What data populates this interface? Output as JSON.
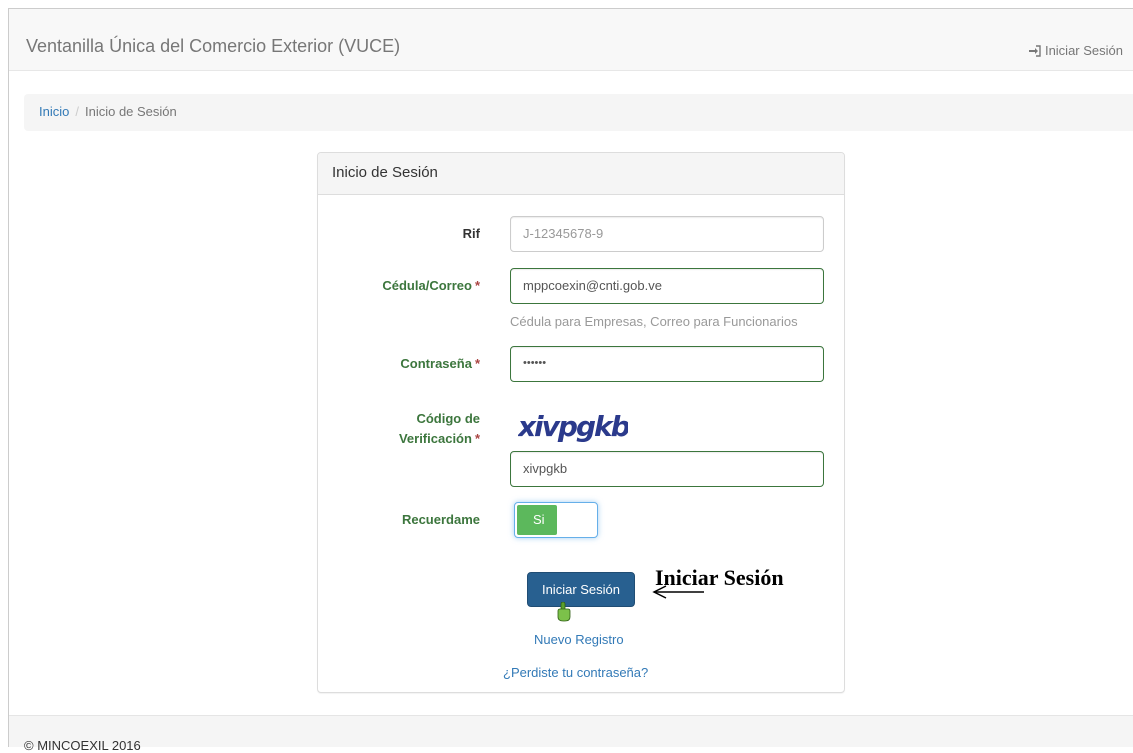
{
  "navbar": {
    "brand": "Ventanilla Única del Comercio Exterior (VUCE)",
    "login_label": "Iniciar Sesión",
    "login_icon": "sign-in-icon"
  },
  "breadcrumb": {
    "home": "Inicio",
    "separator": "/",
    "current": "Inicio de Sesión"
  },
  "panel": {
    "title": "Inicio de Sesión"
  },
  "form": {
    "rif": {
      "label": "Rif",
      "placeholder": "J-12345678-9"
    },
    "cedula": {
      "label": "Cédula/Correo",
      "required": "*",
      "value": "mppcoexin@cnti.gob.ve",
      "help": "Cédula para Empresas, Correo para Funcionarios"
    },
    "password": {
      "label": "Contraseña",
      "required": "*",
      "value": "••••••"
    },
    "captcha": {
      "label_line1": "Código de",
      "label_line2": "Verificación",
      "required": "*",
      "image_text": "xivpgkb",
      "value": "xivpgkb"
    },
    "remember": {
      "label": "Recuerdame",
      "toggle_on": "Si"
    },
    "submit_label": "Iniciar Sesión",
    "register_link": "Nuevo Registro",
    "forgot_link": "¿Perdiste tu contraseña?"
  },
  "annotation": {
    "text": "Iniciar Sesión"
  },
  "footer": {
    "text": "© MINCOEXIL 2016"
  },
  "colors": {
    "success": "#3c763d",
    "primary": "#286090",
    "toggle_on": "#5cb85c",
    "link": "#337ab7",
    "captcha": "#2b3a8c"
  }
}
